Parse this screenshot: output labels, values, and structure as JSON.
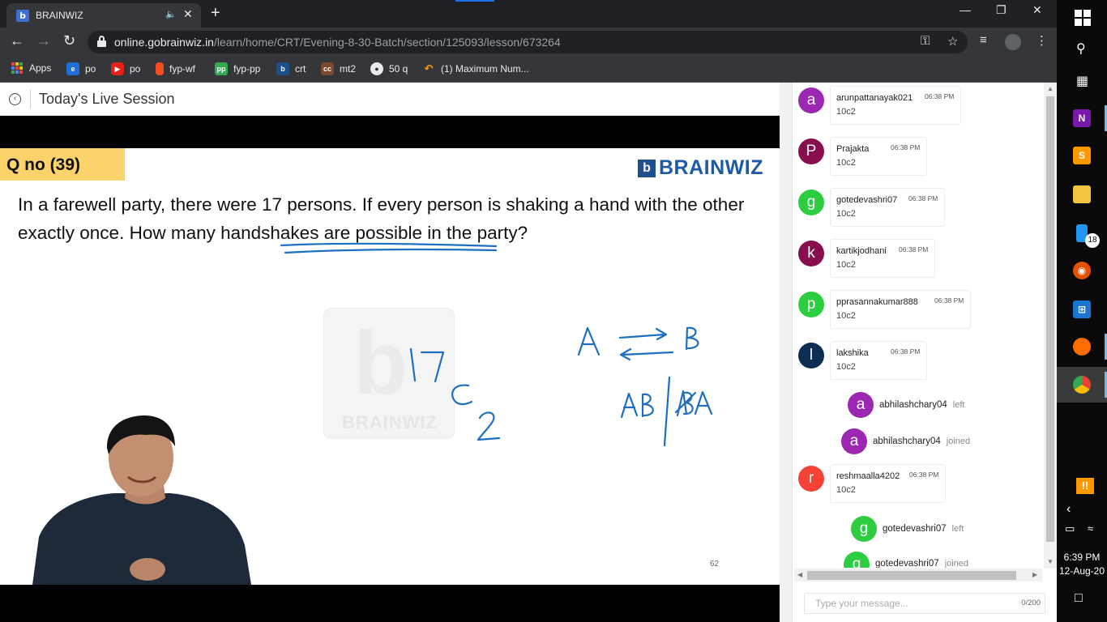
{
  "browser": {
    "tab_title": "BRAINWIZ",
    "tab_favicon": "b",
    "url_host": "online.gobrainwiz.in",
    "url_path": "/learn/home/CRT/Evening-8-30-Batch/section/125093/lesson/673264",
    "bookmarks": [
      {
        "label": "Apps",
        "icon": "apps-grid-icon",
        "color": ""
      },
      {
        "label": "po",
        "icon": "e-icon",
        "color": "#1f6fd6"
      },
      {
        "label": "po",
        "icon": "youtube-icon",
        "color": "#e62117"
      },
      {
        "label": "fyp-wf",
        "icon": "figma-icon",
        "color": "#f24e1e"
      },
      {
        "label": "fyp-pp",
        "icon": "pp-icon",
        "color": "#35a853"
      },
      {
        "label": "crt",
        "icon": "brainwiz-icon",
        "color": "#1f4e8c"
      },
      {
        "label": "mt2",
        "icon": "cc-icon",
        "color": "#7a4a2e"
      },
      {
        "label": "50 q",
        "icon": "globe-icon",
        "color": "#e8eaed"
      },
      {
        "label": "(1) Maximum Num...",
        "icon": "leetcode-icon",
        "color": "#ffa116"
      }
    ]
  },
  "page": {
    "title": "Today's Live Session"
  },
  "slide": {
    "qno": "Q no (39)",
    "brand": "BRAINWIZ",
    "brand_logo": "b",
    "question": "In a farewell party, there were 17 persons. If every person is shaking a hand with the other exactly once. How many handshakes are possible in the party?",
    "watermark_letter": "b",
    "watermark_text": "BRAINWIZ",
    "slide_number": "62"
  },
  "chat": {
    "messages": [
      {
        "initial": "a",
        "color": "#9c27b0",
        "user": "arunpattanayak021",
        "time": "06:38 PM",
        "text": "10c2"
      },
      {
        "initial": "P",
        "color": "#880e4f",
        "user": "Prajakta",
        "time": "06:38 PM",
        "text": "10c2"
      },
      {
        "initial": "g",
        "color": "#2ecc40",
        "user": "gotedevashri07",
        "time": "06:38 PM",
        "text": "10c2"
      },
      {
        "initial": "k",
        "color": "#880e4f",
        "user": "kartikjodhani",
        "time": "06:38 PM",
        "text": "10c2"
      },
      {
        "initial": "p",
        "color": "#2ecc40",
        "user": "pprasannakumar888",
        "time": "06:38 PM",
        "text": "10c2"
      },
      {
        "initial": "l",
        "color": "#0d2d52",
        "user": "lakshika",
        "time": "06:38 PM",
        "text": "10c2"
      },
      {
        "initial": "r",
        "color": "#f44336",
        "user": "reshmaalla4202",
        "time": "06:38 PM",
        "text": "10c2"
      }
    ],
    "events": [
      {
        "initial": "a",
        "color": "#9c27b0",
        "user": "abhilashchary04",
        "status": "left"
      },
      {
        "initial": "a",
        "color": "#9c27b0",
        "user": "abhilashchary04",
        "status": "joined"
      },
      {
        "initial": "g",
        "color": "#2ecc40",
        "user": "gotedevashri07",
        "status": "left"
      },
      {
        "initial": "g",
        "color": "#2ecc40",
        "user": "gotedevashri07",
        "status": "joined"
      }
    ],
    "input_placeholder": "Type your message...",
    "char_count": "0/200"
  },
  "taskbar": {
    "badge": "18",
    "notify": "!!",
    "time": "6:39 PM",
    "date": "12-Aug-20"
  }
}
